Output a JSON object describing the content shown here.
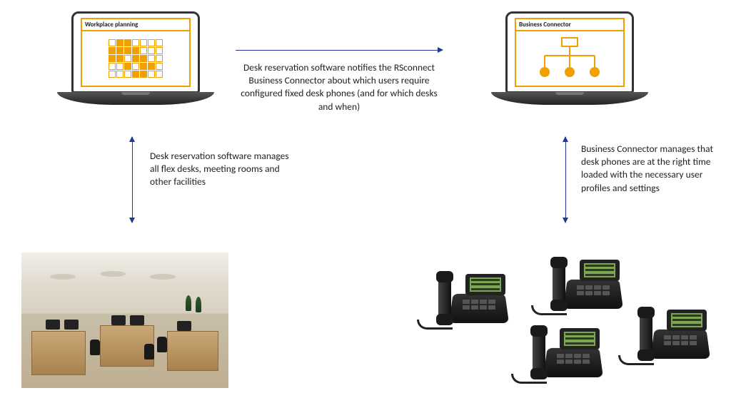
{
  "laptops": {
    "left_title": "Workplace planning",
    "right_title": "Business Connector"
  },
  "captions": {
    "top": "Desk reservation software notifies the RSconnect Business Connector about which users require configured fixed desk phones (and for which desks and when)",
    "left": "Desk reservation software manages all flex desks, meeting rooms and other facilities",
    "right": "Business Connector manages that desk phones are at the right time loaded with the necessary user profiles and settings"
  },
  "colors": {
    "accent": "#f0a000",
    "arrow": "#1f3b8f"
  }
}
